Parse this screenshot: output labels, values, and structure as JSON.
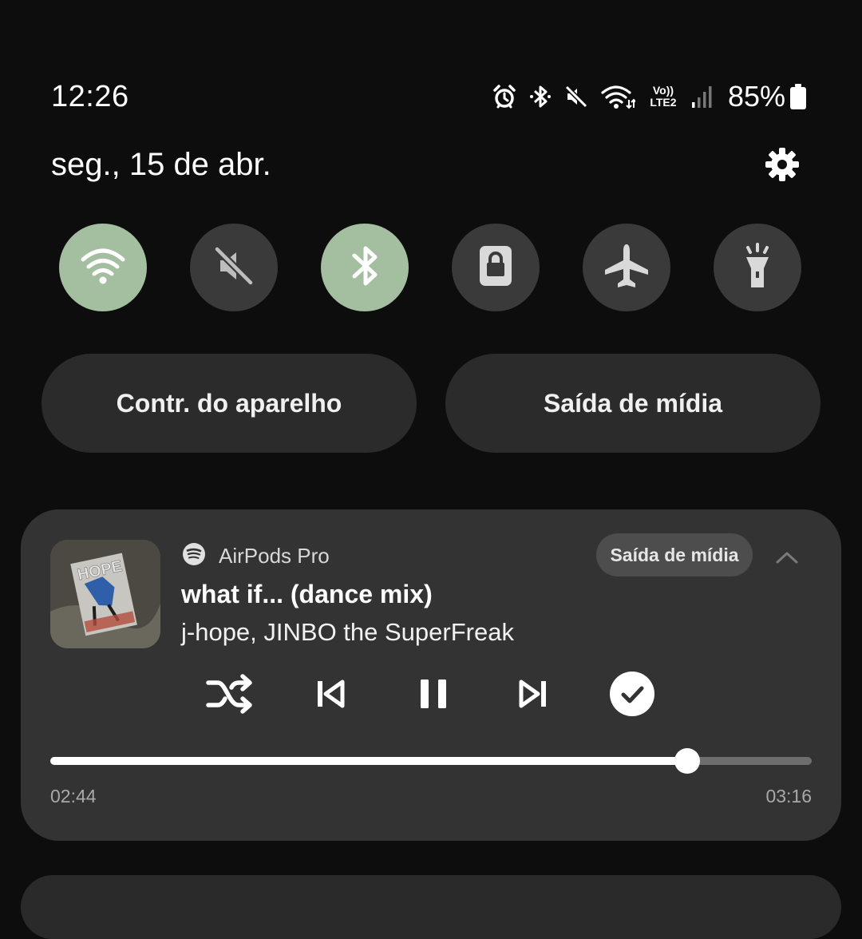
{
  "status_bar": {
    "time": "12:26",
    "network_label": "Vo)) LTE2",
    "battery": "85%",
    "icons": [
      "alarm-icon",
      "bluetooth-icon",
      "mute-icon",
      "wifi-icon",
      "signal-icon",
      "battery-icon"
    ]
  },
  "header": {
    "date": "seg., 15 de abr."
  },
  "quick_settings": [
    {
      "name": "Wi-Fi",
      "icon": "wifi-icon",
      "active": true
    },
    {
      "name": "Som",
      "icon": "mute-icon",
      "active": false
    },
    {
      "name": "Bluetooth",
      "icon": "bluetooth-icon",
      "active": true
    },
    {
      "name": "Bloqueio",
      "icon": "lock-icon",
      "active": false
    },
    {
      "name": "Modo avião",
      "icon": "airplane-icon",
      "active": false
    },
    {
      "name": "Lanterna",
      "icon": "flashlight-icon",
      "active": false
    }
  ],
  "pills": {
    "device_control": "Contr. do aparelho",
    "media_output": "Saída de mídia"
  },
  "media": {
    "source": "AirPods Pro",
    "output_chip": "Saída de mídia",
    "title": "what if... (dance mix)",
    "artist": "j-hope, JINBO the SuperFreak",
    "elapsed": "02:44",
    "duration": "03:16",
    "progress_fraction": 0.837,
    "controls": [
      "shuffle-icon",
      "previous-icon",
      "pause-icon",
      "next-icon",
      "check-icon"
    ],
    "album_art_text": "HOPE"
  },
  "colors": {
    "active_tile": "#a4bea0",
    "inactive_tile": "#3a3a3a",
    "card": "#333333",
    "background": "#0d0d0d"
  }
}
